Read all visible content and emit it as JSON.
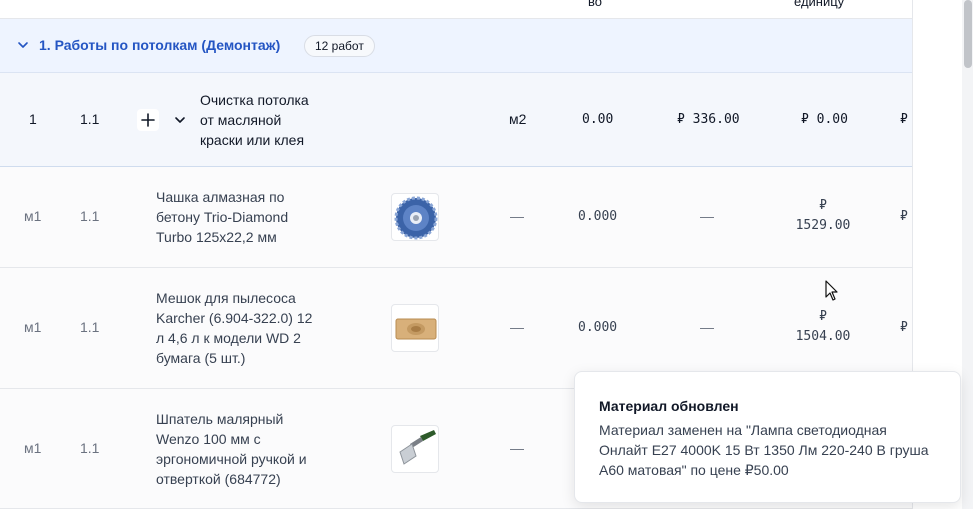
{
  "header": {
    "col_qty_tail": "во",
    "col_price_unit_tail": "единицу"
  },
  "group": {
    "title": "1. Работы по потолкам (Демонтаж)",
    "badge": "12 работ"
  },
  "work_row": {
    "index": "1",
    "code": "1.1",
    "name_lines": [
      "Очистка потолка",
      "от масляной",
      "краски или клея"
    ],
    "unit": "м2",
    "quantity": "0.00",
    "price": "₽ 336.00",
    "price_per_unit": "₽ 0.00",
    "total_partial": "₽"
  },
  "materials": [
    {
      "index": "м1",
      "code": "1.1",
      "name_lines": [
        "Чашка алмазная по",
        "бетону Trio-Diamond",
        "Turbo 125x22,2 мм"
      ],
      "image": "diamond-cup-wheel-image",
      "unit": "—",
      "quantity": "0.000",
      "price": "—",
      "price_per_unit_currency": "₽",
      "price_per_unit_value": "1529.00",
      "total_partial": "₽"
    },
    {
      "index": "м1",
      "code": "1.1",
      "name_lines": [
        "Мешок для пылесоса",
        "Karcher (6.904-322.0) 12",
        "л 4,6 л к модели WD 2",
        "бумага (5 шт.)"
      ],
      "image": "vacuum-bag-image",
      "unit": "—",
      "quantity": "0.000",
      "price": "—",
      "price_per_unit_currency": "₽",
      "price_per_unit_value": "1504.00",
      "total_partial": "₽"
    },
    {
      "index": "м1",
      "code": "1.1",
      "name_lines": [
        "Шпатель малярный",
        "Wenzo 100 мм с",
        "эргономичной ручкой и",
        "отверткой (684772)"
      ],
      "image": "putty-knife-image",
      "unit": "—"
    }
  ],
  "toast": {
    "title": "Материал обновлен",
    "message": "Материал заменен на \"Лампа светодиодная Онлайт E27 4000K 15 Вт 1350 Лм 220-240 В груша A60 матовая\" по цене ₽50.00"
  },
  "colors": {
    "accent": "#2455c3",
    "group_bg": "#eef4ff",
    "work_bg": "#f4f7fc"
  }
}
